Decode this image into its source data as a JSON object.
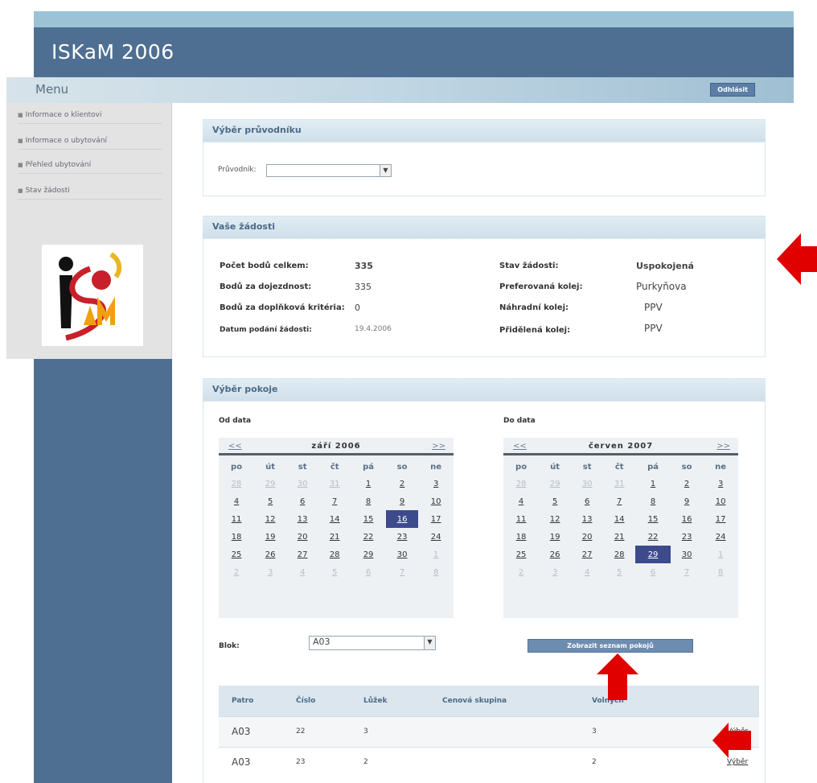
{
  "app": {
    "title": "ISKaM 2006"
  },
  "menubar": {
    "menu_label": "Menu",
    "logout_label": "Odhlásit"
  },
  "sidebar": {
    "items": [
      {
        "label": "Informace o klientovi"
      },
      {
        "label": "Informace o ubytování"
      },
      {
        "label": "Přehled ubytování"
      },
      {
        "label": "Stav žádosti"
      }
    ]
  },
  "panel_guide": {
    "title": "Výběr průvodníku",
    "label": "Průvodník:",
    "value": ""
  },
  "panel_request": {
    "title": "Vaše žádosti",
    "left": [
      {
        "label": "Počet bodů celkem:",
        "value": "335"
      },
      {
        "label": "Bodů za dojezdnost:",
        "value": "335"
      },
      {
        "label": "Bodů za doplňková kritéria:",
        "value": "0"
      },
      {
        "label": "Datum podání žádosti:",
        "value": "19.4.2006"
      }
    ],
    "right": [
      {
        "label": "Stav žádosti:",
        "value": "Uspokojená"
      },
      {
        "label": "Preferovaná kolej:",
        "value": "Purkyňova"
      },
      {
        "label": "Náhradní kolej:",
        "value": "PPV"
      },
      {
        "label": "Přidělená kolej:",
        "value": "PPV"
      }
    ]
  },
  "panel_room": {
    "title": "Výběr pokoje",
    "from_label": "Od data",
    "to_label": "Do data",
    "block_label": "Blok:",
    "block_value": "A03",
    "show_button": "Zobrazit seznam pokojů"
  },
  "calendars": [
    {
      "prev": "<<",
      "next": ">>",
      "month": "září 2006",
      "weekdays": [
        "po",
        "út",
        "st",
        "čt",
        "pá",
        "so",
        "ne"
      ],
      "weeks": [
        [
          "28",
          "29",
          "30",
          "31",
          "1",
          "2",
          "3"
        ],
        [
          "4",
          "5",
          "6",
          "7",
          "8",
          "9",
          "10"
        ],
        [
          "11",
          "12",
          "13",
          "14",
          "15",
          "16",
          "17"
        ],
        [
          "18",
          "19",
          "20",
          "21",
          "22",
          "23",
          "24"
        ],
        [
          "25",
          "26",
          "27",
          "28",
          "29",
          "30",
          "1"
        ],
        [
          "2",
          "3",
          "4",
          "5",
          "6",
          "7",
          "8"
        ]
      ],
      "selected": "16"
    },
    {
      "prev": "<<",
      "next": ">>",
      "month": "červen 2007",
      "weekdays": [
        "po",
        "út",
        "st",
        "čt",
        "pá",
        "so",
        "ne"
      ],
      "weeks": [
        [
          "28",
          "29",
          "30",
          "31",
          "1",
          "2",
          "3"
        ],
        [
          "4",
          "5",
          "6",
          "7",
          "8",
          "9",
          "10"
        ],
        [
          "11",
          "12",
          "13",
          "14",
          "15",
          "16",
          "17"
        ],
        [
          "18",
          "19",
          "20",
          "21",
          "22",
          "23",
          "24"
        ],
        [
          "25",
          "26",
          "27",
          "28",
          "29",
          "30",
          "1"
        ],
        [
          "2",
          "3",
          "4",
          "5",
          "6",
          "7",
          "8"
        ]
      ],
      "selected": "29"
    }
  ],
  "room_table": {
    "headers": [
      "Patro",
      "Číslo",
      "Lůžek",
      "Cenová skupina",
      "Volných",
      ""
    ],
    "rows": [
      {
        "floor": "A03",
        "number": "22",
        "beds": "3",
        "price_group": "",
        "free": "3",
        "action": "Výběr"
      },
      {
        "floor": "A03",
        "number": "23",
        "beds": "2",
        "price_group": "",
        "free": "2",
        "action": "Výběr"
      }
    ]
  },
  "colors": {
    "header_blue": "#4e6f92",
    "annotation_red": "#e00000",
    "selected_day": "#3d4a8c"
  }
}
